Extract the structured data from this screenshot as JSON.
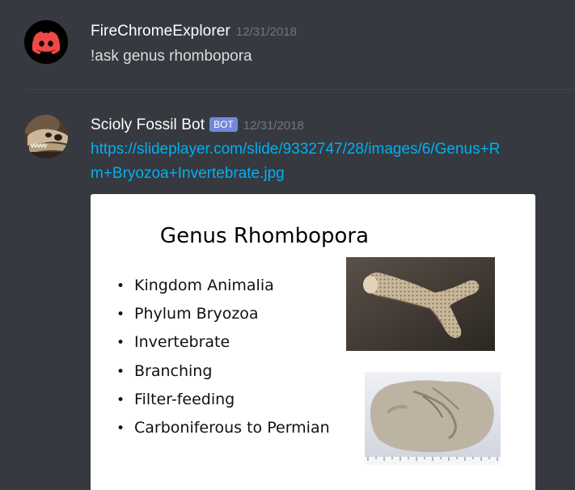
{
  "messages": [
    {
      "username": "FireChromeExplorer",
      "timestamp": "12/31/2018",
      "text": "!ask genus rhombopora"
    },
    {
      "username": "Scioly Fossil Bot",
      "bot_tag": "BOT",
      "timestamp": "12/31/2018",
      "link_line1": "https://slideplayer.com/slide/9332747/28/images/6/Genus+R",
      "link_line2": "m+Bryozoa+Invertebrate.jpg",
      "slide": {
        "title": "Genus Rhombopora",
        "bullets": [
          "Kingdom Animalia",
          "Phylum Bryozoa",
          "Invertebrate",
          "Branching",
          "Filter-feeding",
          "Carboniferous to Permian"
        ]
      }
    }
  ],
  "colors": {
    "background": "#36393f",
    "username": "#ffffff",
    "timestamp": "#72767d",
    "message_text": "#dcddde",
    "link": "#00b0f4",
    "bot_tag": "#7289da",
    "discord_red": "#f04747"
  },
  "icons": {
    "avatar_1": "discord-logo-icon",
    "avatar_2": "trex-skull-icon"
  }
}
